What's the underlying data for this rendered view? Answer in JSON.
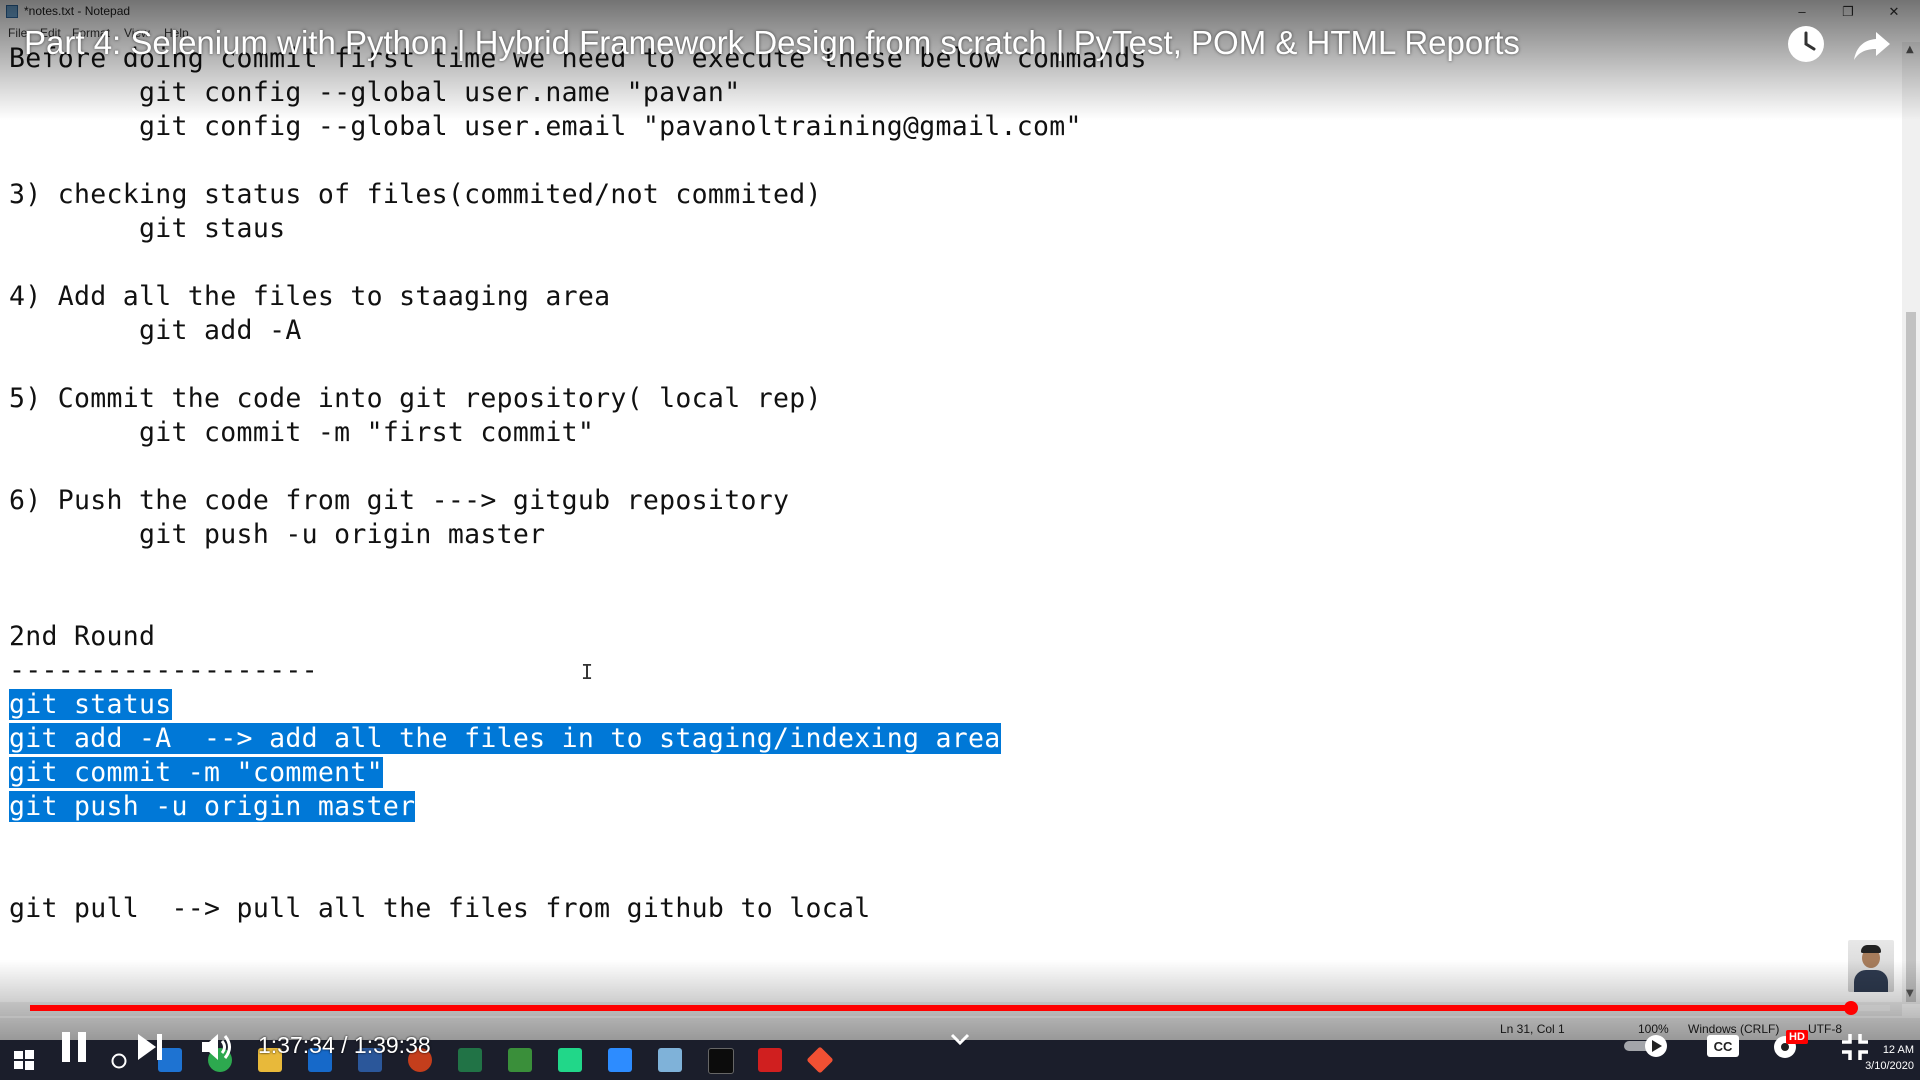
{
  "notepad": {
    "window_title": "*notes.txt - Notepad",
    "menu": [
      "File",
      "Edit",
      "Format",
      "View",
      "Help"
    ],
    "lines": [
      "Before doing commit first time we need to execute these below commands",
      "        git config --global user.name \"pavan\"",
      "        git config --global user.email \"pavanoltraining@gmail.com\"",
      "",
      "3) checking status of files(commited/not commited)",
      "        git staus",
      "",
      "4) Add all the files to staaging area",
      "        git add -A",
      "",
      "5) Commit the code into git repository( local rep)",
      "        git commit -m \"first commit\"",
      "",
      "6) Push the code from git ---> gitgub repository",
      "        git push -u origin master",
      "",
      "",
      "2nd Round",
      "-------------------",
      "git status",
      "git add -A  --> add all the files in to staging/indexing area",
      "git commit -m \"comment\"",
      "git push -u origin master",
      "",
      "",
      "git pull  --> pull all the files from github to local"
    ],
    "selected_line_indices": [
      19,
      20,
      21,
      22
    ],
    "status": {
      "position": "Ln 31, Col 1",
      "zoom": "100%",
      "line_ending": "Windows (CRLF)",
      "encoding": "UTF-8"
    }
  },
  "video": {
    "title": "Part 4: Selenium with Python | Hybrid Framework Design from scratch | PyTest, POM & HTML Reports",
    "current_time": "1:37:34",
    "duration": "1:39:38",
    "time_display": "1:37:34 / 1:39:38",
    "progress_fraction": 0.979,
    "quality_badge": "HD",
    "icons": {
      "watch_later": "clock-icon",
      "share": "share-icon",
      "pause": "pause-icon",
      "next": "next-icon",
      "volume": "volume-icon",
      "autoplay": "autoplay-toggle-icon",
      "captions": "cc-icon",
      "settings": "gear-icon",
      "fullscreen": "exit-fullscreen-icon"
    },
    "accent_color": "#ff0000"
  },
  "taskbar": {
    "clock_time": "12 AM",
    "clock_date": "3/10/2020"
  }
}
